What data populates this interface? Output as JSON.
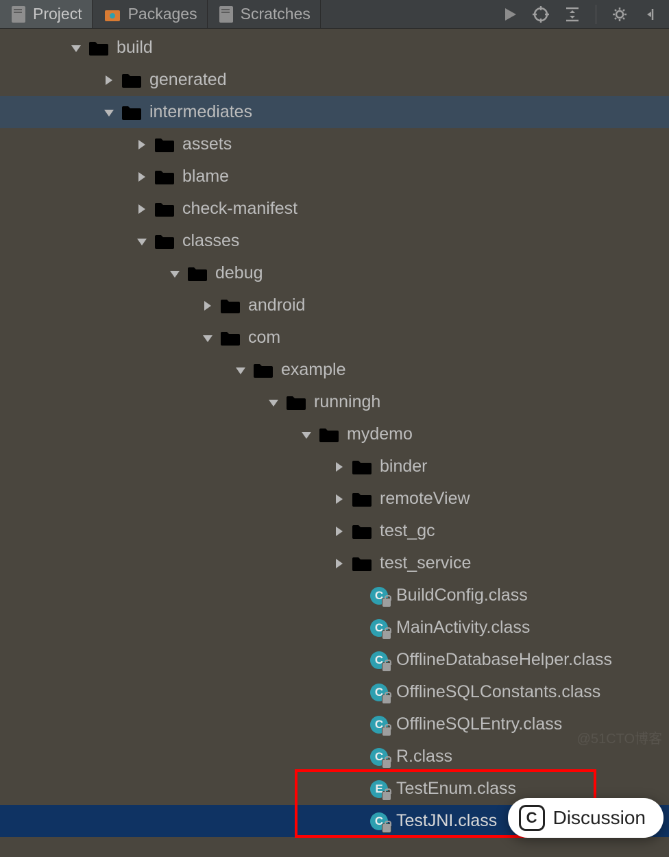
{
  "tabs": {
    "project": {
      "label": "Project"
    },
    "packages": {
      "label": "Packages"
    },
    "scratches": {
      "label": "Scratches"
    }
  },
  "tree": {
    "n0": {
      "label": "build"
    },
    "n1": {
      "label": "generated"
    },
    "n2": {
      "label": "intermediates"
    },
    "n3": {
      "label": "assets"
    },
    "n4": {
      "label": "blame"
    },
    "n5": {
      "label": "check-manifest"
    },
    "n6": {
      "label": "classes"
    },
    "n7": {
      "label": "debug"
    },
    "n8": {
      "label": "android"
    },
    "n9": {
      "label": "com"
    },
    "n10": {
      "label": "example"
    },
    "n11": {
      "label": "runningh"
    },
    "n12": {
      "label": "mydemo"
    },
    "n13": {
      "label": "binder"
    },
    "n14": {
      "label": "remoteView"
    },
    "n15": {
      "label": "test_gc"
    },
    "n16": {
      "label": "test_service"
    },
    "f0": {
      "label": "BuildConfig.class"
    },
    "f1": {
      "label": "MainActivity.class"
    },
    "f2": {
      "label": "OfflineDatabaseHelper.class"
    },
    "f3": {
      "label": "OfflineSQLConstants.class"
    },
    "f4": {
      "label": "OfflineSQLEntry.class"
    },
    "f5": {
      "label": "R.class"
    },
    "f6": {
      "label": "TestEnum.class"
    },
    "f7": {
      "label": "TestJNI.class"
    }
  },
  "discussion": {
    "label": "Discussion",
    "badge": "C"
  }
}
